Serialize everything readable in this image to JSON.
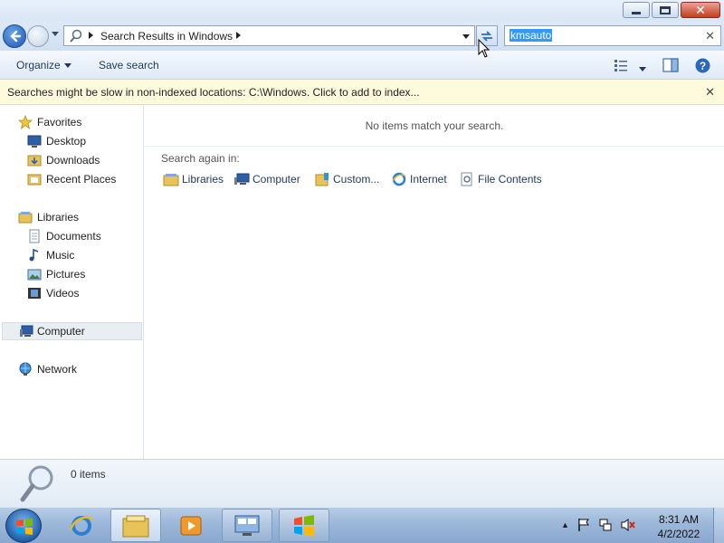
{
  "address": {
    "path_text": "Search Results in Windows"
  },
  "search": {
    "value": "kmsauto"
  },
  "toolbar": {
    "organize_label": "Organize",
    "save_search_label": "Save search"
  },
  "infobar": {
    "message": "Searches might be slow in non-indexed locations: C:\\Windows. Click to add to index..."
  },
  "sidebar": {
    "favorites": {
      "label": "Favorites",
      "items": [
        {
          "label": "Desktop"
        },
        {
          "label": "Downloads"
        },
        {
          "label": "Recent Places"
        }
      ]
    },
    "libraries": {
      "label": "Libraries",
      "items": [
        {
          "label": "Documents"
        },
        {
          "label": "Music"
        },
        {
          "label": "Pictures"
        },
        {
          "label": "Videos"
        }
      ]
    },
    "computer": {
      "label": "Computer"
    },
    "network": {
      "label": "Network"
    }
  },
  "main": {
    "empty_message": "No items match your search.",
    "search_again_label": "Search again in:",
    "search_again_items": [
      {
        "label": "Libraries"
      },
      {
        "label": "Computer"
      },
      {
        "label": "Custom..."
      },
      {
        "label": "Internet"
      },
      {
        "label": "File Contents"
      }
    ]
  },
  "details": {
    "count": "0 items"
  },
  "taskbar": {
    "time": "8:31 AM",
    "date": "4/2/2022"
  }
}
